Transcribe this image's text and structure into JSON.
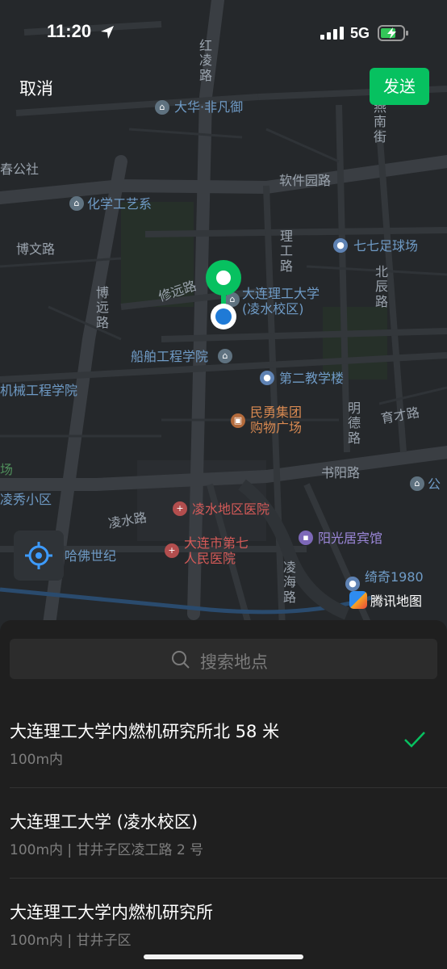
{
  "status_bar": {
    "time": "11:20",
    "network": "5G"
  },
  "header": {
    "cancel_label": "取消",
    "send_label": "发送"
  },
  "map": {
    "labels": {
      "hongling_road": "红凌路",
      "dahua": "大华·非凡御",
      "yannan_st": "燕南街",
      "chun_gongshe": "春公社",
      "software_park_road": "软件园路",
      "chem_art": "化学工艺系",
      "bowen_road": "博文路",
      "ligong_road": "理工路",
      "qiqi_stadium": "七七足球场",
      "beichen_road": "北辰路",
      "xiuyuan_road": "修远路",
      "boyuan_road": "博远路",
      "dut": "大连理工大学",
      "dut_campus": "(凌水校区)",
      "shipbuilding": "船舶工程学院",
      "mechanical": "机械工程学院",
      "teaching2": "第二教学楼",
      "mingde_road": "明德路",
      "yucai_road": "育才路",
      "minyong1": "民勇集团",
      "minyong2": "购物广场",
      "shuyang_road": "书阳路",
      "gong": "公",
      "lingxiu": "凌秀小区",
      "yang": "场",
      "lingshui_road": "凌水路",
      "lingshui_hospital": "凌水地区医院",
      "yangguang_hotel": "阳光居宾馆",
      "harvard": "哈佛世纪",
      "hospital7_1": "大连市第七",
      "hospital7_2": "人民医院",
      "linghai_road": "凌海路",
      "qiqi1980": "绮奇1980"
    },
    "attribution": "腾讯地图",
    "colors": {
      "background": "#25282b",
      "road": "#3a3e43",
      "pin": "#07c160",
      "dot": "#1f7ad6"
    }
  },
  "search": {
    "placeholder": "搜索地点"
  },
  "results": [
    {
      "title": "大连理工大学内燃机研究所北 58 米",
      "subtitle": "100m内",
      "selected": true
    },
    {
      "title": "大连理工大学 (凌水校区)",
      "subtitle": "100m内 | 甘井子区凌工路 2 号",
      "selected": false
    },
    {
      "title": "大连理工大学内燃机研究所",
      "subtitle": "100m内 | 甘井子区",
      "selected": false
    }
  ]
}
